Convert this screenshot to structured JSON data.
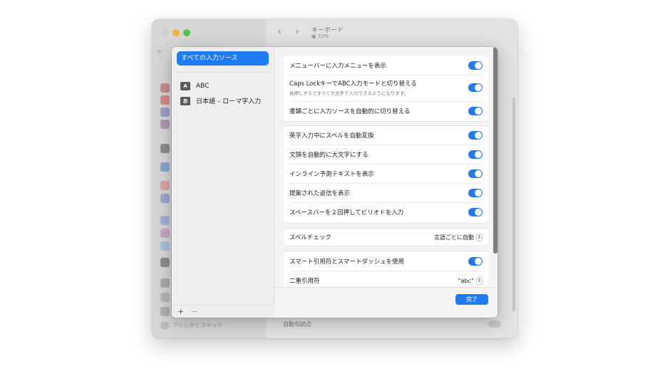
{
  "background_window": {
    "title": "キーボード",
    "battery": "▣ 33%",
    "back_glyph": "‹",
    "forward_glyph": "›",
    "search_glyph": "⌕",
    "sidebar_bottom_item": "プリンタとスキャナ",
    "main_bottom_setting": "自動句読点"
  },
  "sheet": {
    "sources": {
      "all_label": "すべての入力ソース",
      "items": [
        {
          "badge": "A",
          "label": "ABC"
        },
        {
          "badge": "あ",
          "label": "日本語 – ローマ字入力"
        }
      ],
      "add_glyph": "+",
      "remove_glyph": "−"
    },
    "groups": [
      {
        "rows": [
          {
            "label": "メニューバーに入力メニューを表示",
            "control": "toggle",
            "on": true
          },
          {
            "label": "Caps LockキーでABC入力モードと切り替える",
            "sub": "長押しするとすべて大文字で入力できるようになります。",
            "control": "toggle",
            "on": true
          },
          {
            "label": "書類ごとに入力ソースを自動的に切り替える",
            "control": "toggle",
            "on": true
          }
        ]
      },
      {
        "rows": [
          {
            "label": "英字入力中にスペルを自動変換",
            "control": "toggle",
            "on": true
          },
          {
            "label": "文頭を自動的に大文字にする",
            "control": "toggle",
            "on": true
          },
          {
            "label": "インライン予測テキストを表示",
            "control": "toggle",
            "on": true
          },
          {
            "label": "提案された返信を表示",
            "control": "toggle",
            "on": true
          },
          {
            "label": "スペースバーを２回押してピリオドを入力",
            "control": "toggle",
            "on": true
          }
        ]
      },
      {
        "rows": [
          {
            "label": "スペルチェック",
            "control": "popup",
            "value": "言語ごとに自動"
          }
        ]
      },
      {
        "rows": [
          {
            "label": "スマート引用符とスマートダッシュを使用",
            "control": "toggle",
            "on": true
          },
          {
            "label": "二重引用符",
            "control": "popup",
            "value": "“abc”"
          }
        ]
      }
    ],
    "popup_arrow_glyph": "⌃⌄",
    "done_label": "完了"
  },
  "colors": {
    "accent": "#1f7bf2",
    "traffic_yellow": "#f1b43a",
    "traffic_green": "#4fc446"
  }
}
